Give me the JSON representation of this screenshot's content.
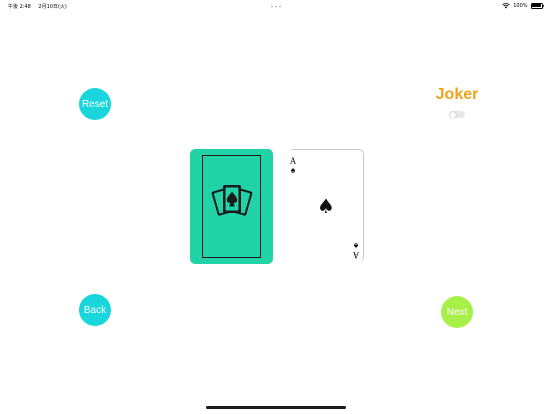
{
  "status_bar": {
    "time": "午後 2:48",
    "date": "2月10日(火)",
    "battery_percent": "100%",
    "wifi_icon": "wifi-icon",
    "battery_icon": "battery-icon"
  },
  "buttons": {
    "reset_label": "Reset",
    "back_label": "Back",
    "next_label": "Next"
  },
  "joker": {
    "label": "Joker",
    "toggle_on": false
  },
  "cards": {
    "back_emblem_icon": "card-fan-spade-icon",
    "face_rank": "A",
    "face_suit": "♠"
  },
  "colors": {
    "reset_back_button": "#19d6dc",
    "next_button": "#a8ef4a",
    "joker_text": "#f0a21d",
    "card_back": "#22d3a8"
  }
}
